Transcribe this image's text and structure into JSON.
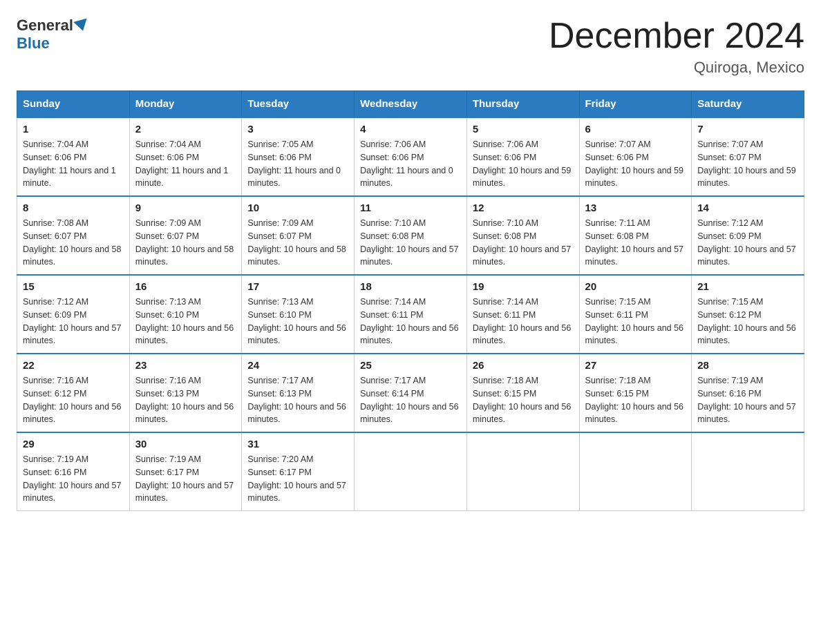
{
  "header": {
    "logo": {
      "general": "General",
      "blue": "Blue"
    },
    "title": "December 2024",
    "location": "Quiroga, Mexico"
  },
  "weekdays": [
    "Sunday",
    "Monday",
    "Tuesday",
    "Wednesday",
    "Thursday",
    "Friday",
    "Saturday"
  ],
  "weeks": [
    [
      {
        "day": "1",
        "sunrise": "7:04 AM",
        "sunset": "6:06 PM",
        "daylight": "11 hours and 1 minute."
      },
      {
        "day": "2",
        "sunrise": "7:04 AM",
        "sunset": "6:06 PM",
        "daylight": "11 hours and 1 minute."
      },
      {
        "day": "3",
        "sunrise": "7:05 AM",
        "sunset": "6:06 PM",
        "daylight": "11 hours and 0 minutes."
      },
      {
        "day": "4",
        "sunrise": "7:06 AM",
        "sunset": "6:06 PM",
        "daylight": "11 hours and 0 minutes."
      },
      {
        "day": "5",
        "sunrise": "7:06 AM",
        "sunset": "6:06 PM",
        "daylight": "10 hours and 59 minutes."
      },
      {
        "day": "6",
        "sunrise": "7:07 AM",
        "sunset": "6:06 PM",
        "daylight": "10 hours and 59 minutes."
      },
      {
        "day": "7",
        "sunrise": "7:07 AM",
        "sunset": "6:07 PM",
        "daylight": "10 hours and 59 minutes."
      }
    ],
    [
      {
        "day": "8",
        "sunrise": "7:08 AM",
        "sunset": "6:07 PM",
        "daylight": "10 hours and 58 minutes."
      },
      {
        "day": "9",
        "sunrise": "7:09 AM",
        "sunset": "6:07 PM",
        "daylight": "10 hours and 58 minutes."
      },
      {
        "day": "10",
        "sunrise": "7:09 AM",
        "sunset": "6:07 PM",
        "daylight": "10 hours and 58 minutes."
      },
      {
        "day": "11",
        "sunrise": "7:10 AM",
        "sunset": "6:08 PM",
        "daylight": "10 hours and 57 minutes."
      },
      {
        "day": "12",
        "sunrise": "7:10 AM",
        "sunset": "6:08 PM",
        "daylight": "10 hours and 57 minutes."
      },
      {
        "day": "13",
        "sunrise": "7:11 AM",
        "sunset": "6:08 PM",
        "daylight": "10 hours and 57 minutes."
      },
      {
        "day": "14",
        "sunrise": "7:12 AM",
        "sunset": "6:09 PM",
        "daylight": "10 hours and 57 minutes."
      }
    ],
    [
      {
        "day": "15",
        "sunrise": "7:12 AM",
        "sunset": "6:09 PM",
        "daylight": "10 hours and 57 minutes."
      },
      {
        "day": "16",
        "sunrise": "7:13 AM",
        "sunset": "6:10 PM",
        "daylight": "10 hours and 56 minutes."
      },
      {
        "day": "17",
        "sunrise": "7:13 AM",
        "sunset": "6:10 PM",
        "daylight": "10 hours and 56 minutes."
      },
      {
        "day": "18",
        "sunrise": "7:14 AM",
        "sunset": "6:11 PM",
        "daylight": "10 hours and 56 minutes."
      },
      {
        "day": "19",
        "sunrise": "7:14 AM",
        "sunset": "6:11 PM",
        "daylight": "10 hours and 56 minutes."
      },
      {
        "day": "20",
        "sunrise": "7:15 AM",
        "sunset": "6:11 PM",
        "daylight": "10 hours and 56 minutes."
      },
      {
        "day": "21",
        "sunrise": "7:15 AM",
        "sunset": "6:12 PM",
        "daylight": "10 hours and 56 minutes."
      }
    ],
    [
      {
        "day": "22",
        "sunrise": "7:16 AM",
        "sunset": "6:12 PM",
        "daylight": "10 hours and 56 minutes."
      },
      {
        "day": "23",
        "sunrise": "7:16 AM",
        "sunset": "6:13 PM",
        "daylight": "10 hours and 56 minutes."
      },
      {
        "day": "24",
        "sunrise": "7:17 AM",
        "sunset": "6:13 PM",
        "daylight": "10 hours and 56 minutes."
      },
      {
        "day": "25",
        "sunrise": "7:17 AM",
        "sunset": "6:14 PM",
        "daylight": "10 hours and 56 minutes."
      },
      {
        "day": "26",
        "sunrise": "7:18 AM",
        "sunset": "6:15 PM",
        "daylight": "10 hours and 56 minutes."
      },
      {
        "day": "27",
        "sunrise": "7:18 AM",
        "sunset": "6:15 PM",
        "daylight": "10 hours and 56 minutes."
      },
      {
        "day": "28",
        "sunrise": "7:19 AM",
        "sunset": "6:16 PM",
        "daylight": "10 hours and 57 minutes."
      }
    ],
    [
      {
        "day": "29",
        "sunrise": "7:19 AM",
        "sunset": "6:16 PM",
        "daylight": "10 hours and 57 minutes."
      },
      {
        "day": "30",
        "sunrise": "7:19 AM",
        "sunset": "6:17 PM",
        "daylight": "10 hours and 57 minutes."
      },
      {
        "day": "31",
        "sunrise": "7:20 AM",
        "sunset": "6:17 PM",
        "daylight": "10 hours and 57 minutes."
      },
      null,
      null,
      null,
      null
    ]
  ],
  "labels": {
    "sunrise": "Sunrise:",
    "sunset": "Sunset:",
    "daylight": "Daylight:"
  }
}
